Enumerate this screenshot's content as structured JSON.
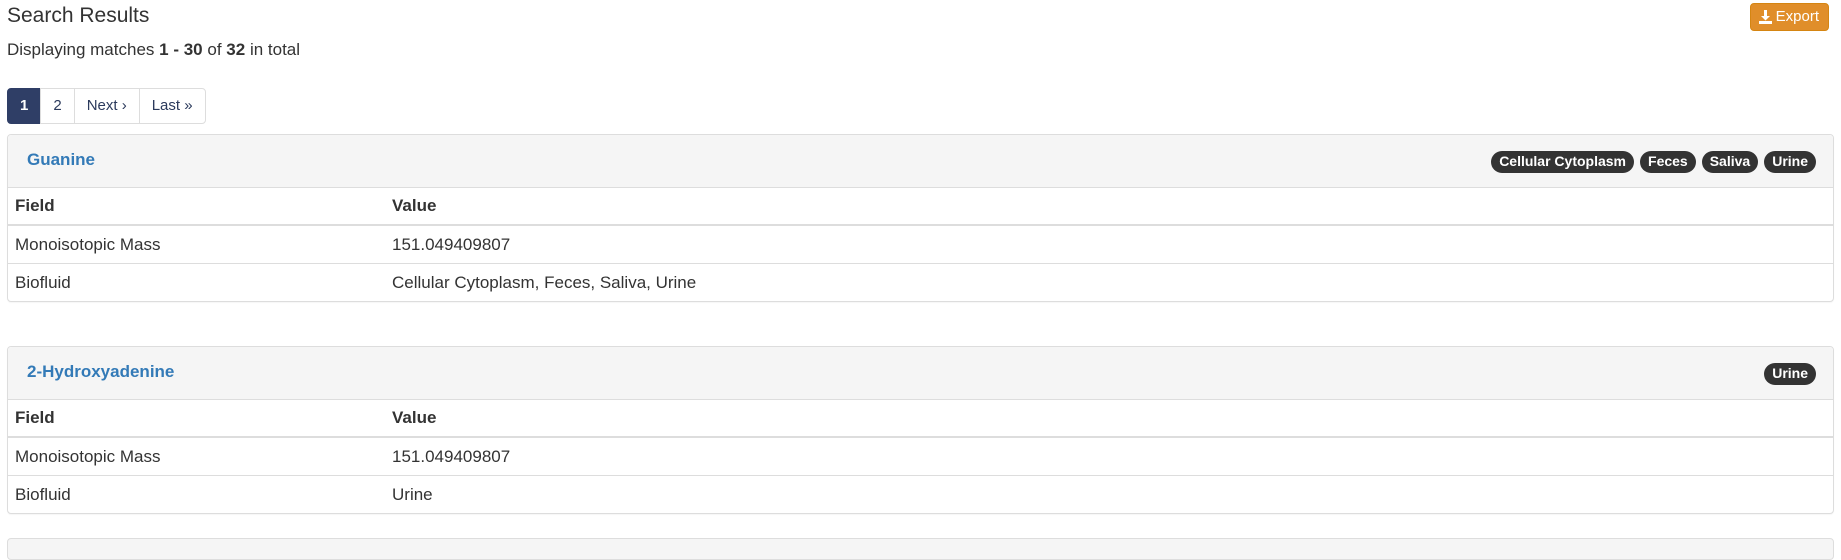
{
  "header": {
    "title": "Search Results",
    "export_label": "Export",
    "summary": {
      "prefix": "Displaying matches",
      "range": "1 - 30",
      "of": "of",
      "total": "32",
      "suffix": "in total"
    }
  },
  "pagination": {
    "pages": [
      "1",
      "2"
    ],
    "current": "1",
    "next_label": "Next ›",
    "last_label": "Last »"
  },
  "results": [
    {
      "name": "Guanine",
      "badges": [
        "Cellular Cytoplasm",
        "Feces",
        "Saliva",
        "Urine"
      ],
      "table": {
        "headers": [
          "Field",
          "Value"
        ],
        "rows": [
          [
            "Monoisotopic Mass",
            "151.049409807"
          ],
          [
            "Biofluid",
            "Cellular Cytoplasm, Feces, Saliva, Urine"
          ]
        ]
      }
    },
    {
      "name": "2-Hydroxyadenine",
      "badges": [
        "Urine"
      ],
      "table": {
        "headers": [
          "Field",
          "Value"
        ],
        "rows": [
          [
            "Monoisotopic Mass",
            "151.049409807"
          ],
          [
            "Biofluid",
            "Urine"
          ]
        ]
      }
    }
  ],
  "icons": {
    "export": "download-icon"
  },
  "colors": {
    "link": "#337ab7",
    "export": "#e08e2a",
    "active_page": "#2f3e66",
    "badge": "#333333"
  }
}
